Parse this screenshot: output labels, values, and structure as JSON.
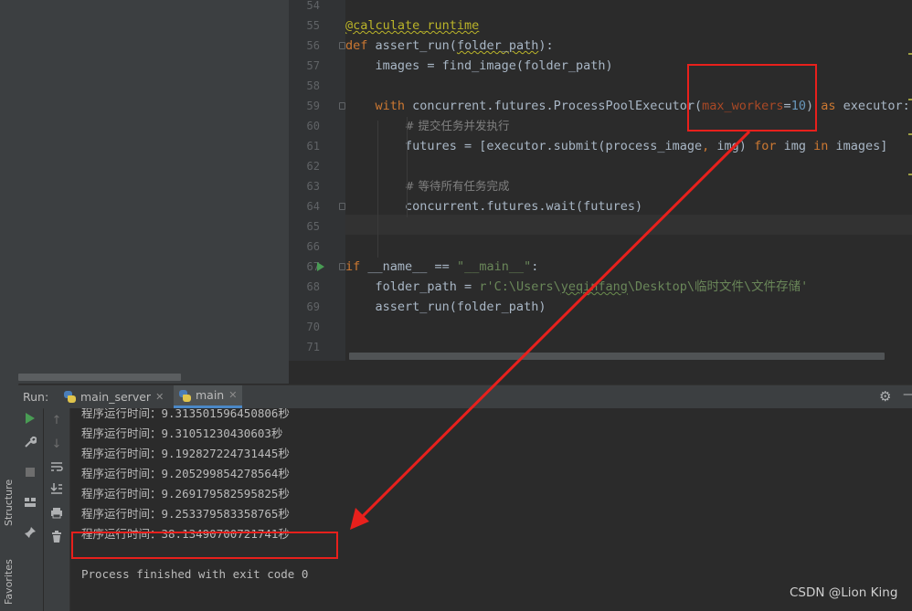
{
  "editor": {
    "lines": [
      {
        "num": "54",
        "html": ""
      },
      {
        "num": "55",
        "html": "<span class='deco warn-underline'>@calculate_runtime</span>"
      },
      {
        "num": "56",
        "html": "<span class='kw'>def</span> assert_run(<span class='warn-underline'>folder_path</span>):"
      },
      {
        "num": "57",
        "html": "    images = find_image(folder_path)"
      },
      {
        "num": "58",
        "html": ""
      },
      {
        "num": "59",
        "html": "    <span class='kw'>with</span> concurrent.futures.ProcessPoolExecutor(<span class='param'>max_workers</span>=<span class='num'>10</span>) <span class='kw'>as</span> executor:"
      },
      {
        "num": "60",
        "html": "        <span class='cmt'># 提交任务并发执行</span>"
      },
      {
        "num": "61",
        "html": "        futures = [executor.submit(process_image<span class='kw'>,</span> img) <span class='kw'>for</span> img <span class='kw'>in</span> images]"
      },
      {
        "num": "62",
        "html": ""
      },
      {
        "num": "63",
        "html": "        <span class='cmt'># 等待所有任务完成</span>"
      },
      {
        "num": "64",
        "html": "        concurrent.futures.wait(futures)"
      },
      {
        "num": "65",
        "html": ""
      },
      {
        "num": "66",
        "html": ""
      },
      {
        "num": "67",
        "html": "<span class='kw'>if</span> __name__ == <span class='str'>\"__main__\"</span>:"
      },
      {
        "num": "68",
        "html": "    folder_path = <span class='str'>r'C:\\Users\\<span class='typo-underline'>yeqinfang</span>\\Desktop\\临时文件\\文件存储'</span>"
      },
      {
        "num": "69",
        "html": "    assert_run(folder_path)"
      },
      {
        "num": "70",
        "html": ""
      },
      {
        "num": "71",
        "html": ""
      }
    ]
  },
  "run_panel": {
    "label": "Run:",
    "tabs": [
      {
        "label": "main_server",
        "close": "✕"
      },
      {
        "label": "main",
        "close": "✕"
      }
    ],
    "output": [
      "程序运行时间：9.313501596450806秒",
      "程序运行时间：9.31051230430603秒",
      "程序运行时间：9.192827224731445秒",
      "程序运行时间：9.205299854278564秒",
      "程序运行时间：9.269179582595825秒",
      "程序运行时间：9.253379583358765秒",
      "程序运行时间：38.13490700721741秒",
      "",
      "Process finished with exit code 0"
    ]
  },
  "side_tabs": {
    "structure": "Structure",
    "favorites": "Favorites"
  },
  "watermark": "CSDN @Lion King",
  "colors": {
    "annotation_red": "#e8201c",
    "keyword": "#cc7832",
    "number": "#6897bb",
    "string": "#6a8759"
  }
}
